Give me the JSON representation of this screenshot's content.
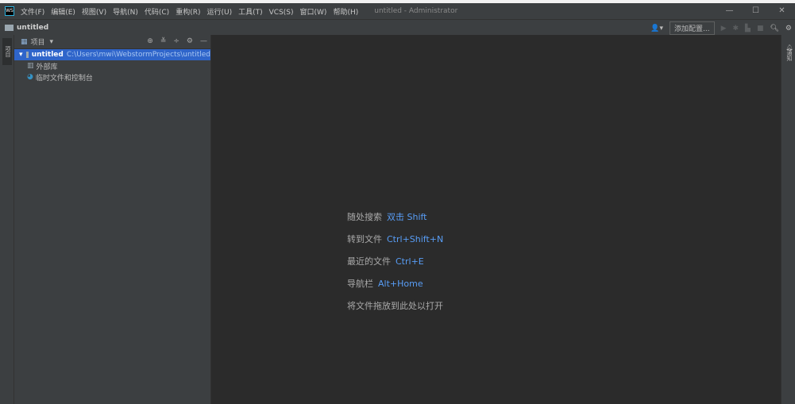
{
  "window": {
    "title": "untitled - Administrator",
    "menu": [
      "文件(F)",
      "编辑(E)",
      "视图(V)",
      "导航(N)",
      "代码(C)",
      "重构(R)",
      "运行(U)",
      "工具(T)",
      "VCS(S)",
      "窗口(W)",
      "帮助(H)"
    ],
    "controls": [
      "—",
      "☐",
      "✕"
    ]
  },
  "navbar": {
    "breadcrumb": "untitled",
    "add_config": "添加配置..."
  },
  "left_strip": {
    "tab": "项目"
  },
  "right_strip": {
    "tab": "通知"
  },
  "project_panel": {
    "title": "项目",
    "tree": [
      {
        "label": "untitled",
        "path": "C:\\Users\\mwi\\WebstormProjects\\untitled",
        "selected": true
      },
      {
        "label": "外部库"
      },
      {
        "label": "临时文件和控制台"
      }
    ]
  },
  "editor": {
    "hints": [
      {
        "label": "随处搜索",
        "key": "双击 Shift"
      },
      {
        "label": "转到文件",
        "key": "Ctrl+Shift+N"
      },
      {
        "label": "最近的文件",
        "key": "Ctrl+E"
      },
      {
        "label": "导航栏",
        "key": "Alt+Home"
      },
      {
        "label": "将文件拖放到此处以打开",
        "key": ""
      }
    ]
  },
  "colors": {
    "accent": "#589df6",
    "selection": "#2f65ca",
    "background": "#2b2b2b",
    "panel": "#3c3f41"
  }
}
